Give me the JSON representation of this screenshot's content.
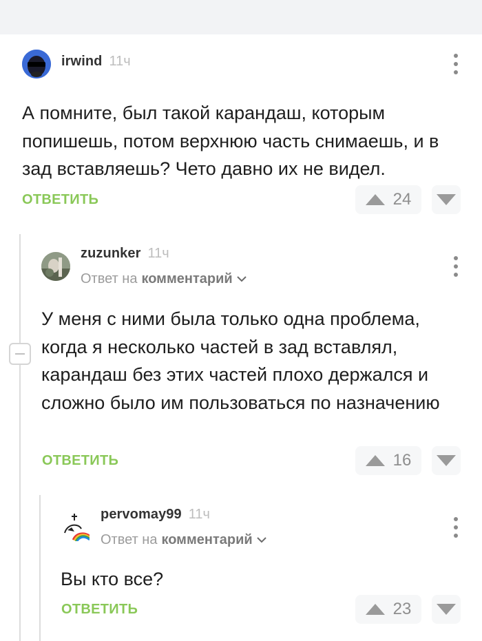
{
  "comments": [
    {
      "username": "irwind",
      "time": "11ч",
      "text": "А помните, был такой карандаш, которым попишешь, потом верхнюю часть снимаешь, и в зад вставляешь? Чето давно их не видел.",
      "reply_label": "ОТВЕТИТЬ",
      "rating": "24"
    },
    {
      "username": "zuzunker",
      "time": "11ч",
      "reply_to_prefix": "Ответ на",
      "reply_to_target": "комментарий",
      "text": "У меня с ними была только одна проблема, когда я несколько частей в зад вставлял, карандаш без этих частей плохо держался и сложно было им пользоваться по назначению",
      "reply_label": "ОТВЕТИТЬ",
      "rating": "16"
    },
    {
      "username": "pervomay99",
      "time": "11ч",
      "reply_to_prefix": "Ответ на",
      "reply_to_target": "комментарий",
      "text": "Вы кто все?",
      "reply_label": "ОТВЕТИТЬ",
      "rating": "23"
    }
  ],
  "colors": {
    "accent_green": "#8ac858",
    "top_bar": "#f2f3f5",
    "vote_bg": "#f6f7f8"
  }
}
